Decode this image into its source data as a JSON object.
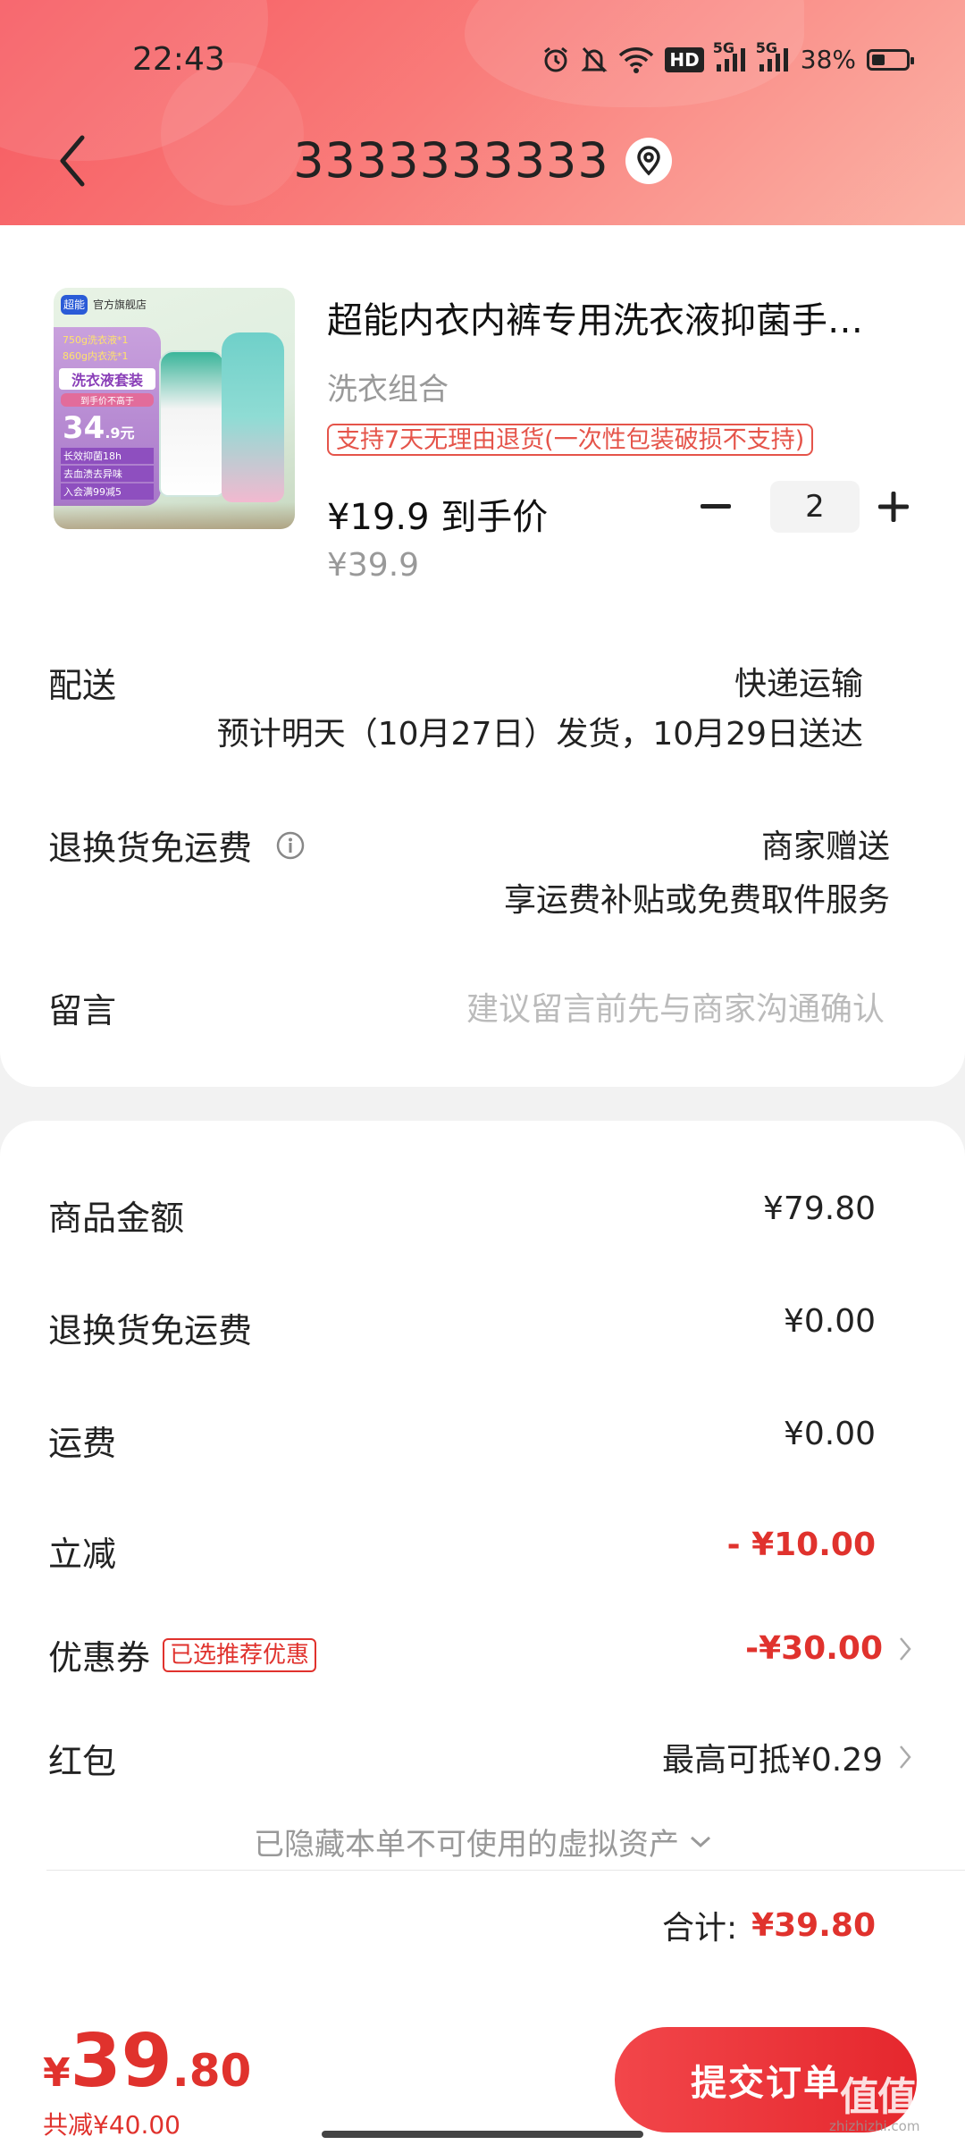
{
  "status_bar": {
    "time": "22:43",
    "network_hd": "HD",
    "network_5g_1": "5G",
    "network_5g_2": "5G",
    "battery_percent": "38%",
    "icons": [
      "alarm-icon",
      "bell-off-icon",
      "wifi-icon",
      "hd-icon",
      "signal-5g-icon",
      "signal-5g-icon",
      "battery-icon"
    ]
  },
  "header": {
    "title": "3333333333",
    "back_icon": "chevron-left-icon",
    "location_icon": "location-pin-icon"
  },
  "product": {
    "name": "超能内衣内裤专用洗衣液抑菌手…",
    "spec": "洗衣组合",
    "return_badge": "支持7天无理由退货(一次性包装破损不支持)",
    "price": "¥19.9 到手价",
    "original_price": "¥39.9",
    "quantity": "2",
    "image": {
      "store_tag": "官方旗舰店",
      "brand": "超能",
      "promo_line1": "750g洗衣液*1",
      "promo_line2": "860g内衣洗*1",
      "set_title": "洗衣液套装",
      "set_sub": "到手价不高于",
      "price_big": "34",
      "price_small": ".9元",
      "feat1": "长效抑菌18h",
      "feat2": "去血渍去异味",
      "feat3": "入会满99减5"
    }
  },
  "delivery": {
    "label": "配送",
    "method": "快递运输",
    "estimate": "预计明天（10月27日）发货，10月29日送达"
  },
  "return_freight": {
    "label": "退换货免运费",
    "value": "商家赠送",
    "desc": "享运费补贴或免费取件服务",
    "info_icon": "info-icon"
  },
  "message": {
    "label": "留言",
    "placeholder": "建议留言前先与商家沟通确认"
  },
  "summary": {
    "goods_amount_label": "商品金额",
    "goods_amount": "¥79.80",
    "return_freight_label": "退换货免运费",
    "return_freight": "¥0.00",
    "shipping_label": "运费",
    "shipping": "¥0.00",
    "instant_discount_label": "立减",
    "instant_discount": "- ¥10.00",
    "coupon_label": "优惠券",
    "coupon_tag": "已选推荐优惠",
    "coupon_value": "-¥30.00",
    "red_packet_label": "红包",
    "red_packet_value": "最高可抵¥0.29",
    "hidden_assets": "已隐藏本单不可使用的虚拟资产",
    "total_label": "合计:",
    "total_value": "¥39.80"
  },
  "bottom": {
    "currency": "¥",
    "price_int": "39",
    "price_dec": ".80",
    "total_saved": "共减¥40.00",
    "submit_label": "提交订单",
    "watermark": "值值值",
    "watermark_url": "zhizhizhi.com"
  },
  "colors": {
    "accent": "#e0322d",
    "header_gradient_start": "#f6585f",
    "header_gradient_end": "#fbb3a6"
  }
}
